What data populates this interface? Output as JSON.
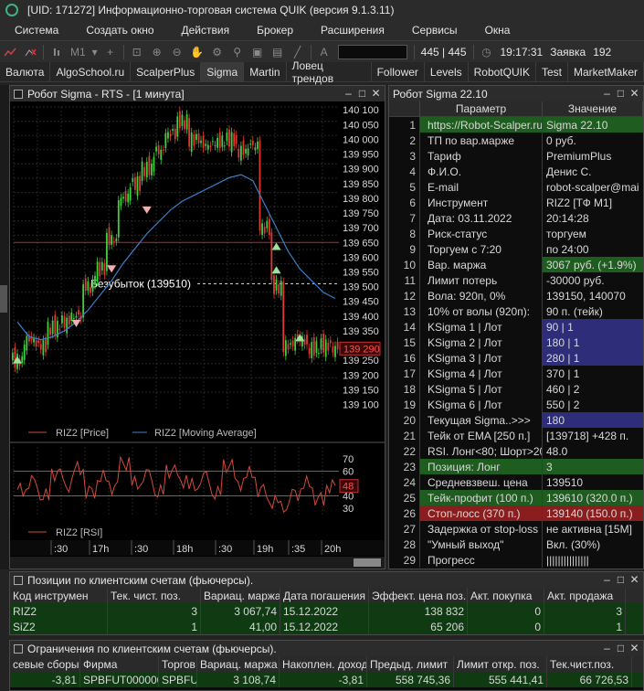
{
  "window": {
    "title": "[UID: 171272] Информационно-торговая система QUIK (версия 9.1.3.11)"
  },
  "menu": [
    "Система",
    "Создать окно",
    "Действия",
    "Брокер",
    "Расширения",
    "Сервисы",
    "Окна"
  ],
  "toolbar": {
    "timeframe": "M1",
    "counter": "445 | 445",
    "time": "19:17:31",
    "orders_label": "Заявка",
    "orders_count": "192"
  },
  "tabs": [
    "Валюта",
    "AlgoSchool.ru",
    "ScalperPlus",
    "Sigma",
    "Martin",
    "Ловец трендов",
    "Follower",
    "Levels",
    "RobotQUIK",
    "Test",
    "MarketMaker"
  ],
  "active_tab": "Sigma",
  "chart_window": {
    "title": "Робот Sigma - RTS  - [1 минута]"
  },
  "chart_data": [
    {
      "type": "line",
      "series": [
        {
          "name": "RIZ2 [Price]",
          "color": "#d24a3a"
        },
        {
          "name": "RIZ2 [Moving Average]",
          "color": "#3a7fc8"
        }
      ],
      "x": [
        "13:15",
        "13:30",
        "13:45",
        "14:00",
        "14:15",
        "14:30",
        "14:45",
        "15:00",
        "15:15",
        "15:30",
        "15:45",
        "16:00",
        "16:15",
        "16:30",
        "16:45",
        "17:00",
        "17:15",
        "17:30",
        "17:45",
        "18:00",
        "18:15",
        "18:30",
        "18:45",
        "19:00",
        "19:15",
        "19:30",
        "19:45",
        "20:00"
      ],
      "price": [
        139250,
        139320,
        139300,
        139360,
        139380,
        139400,
        139500,
        139560,
        139660,
        139800,
        139850,
        139900,
        139960,
        140020,
        140060,
        140000,
        139980,
        139990,
        140000,
        139960,
        139980,
        139700,
        139500,
        139300,
        139320,
        139290,
        139300,
        139290
      ],
      "ma": [
        139380,
        139330,
        139320,
        139330,
        139350,
        139380,
        139420,
        139470,
        139520,
        139580,
        139630,
        139680,
        139720,
        139760,
        139790,
        139810,
        139830,
        139850,
        139870,
        139880,
        139860,
        139780,
        139700,
        139620,
        139560,
        139520,
        139480,
        139460
      ],
      "ylim": [
        139080,
        140110
      ],
      "yticks": [
        "140 100",
        "140 050",
        "140 000",
        "139 950",
        "139 900",
        "139 850",
        "139 800",
        "139 750",
        "139 700",
        "139 650",
        "139 600",
        "139 550",
        "139 500",
        "139 450",
        "139 400",
        "139 350",
        "139 300",
        "139 250",
        "139 200",
        "139 150",
        "139 100"
      ],
      "risk_level": 139650,
      "breakeven": {
        "label": "Безубыток (139510)",
        "value": 139510
      },
      "last_price": "139 290"
    },
    {
      "type": "line",
      "series": [
        {
          "name": "RIZ2 [RSI]",
          "color": "#d24a3a"
        }
      ],
      "ylim": [
        25,
        75
      ],
      "yticks": [
        "70",
        "60",
        "50",
        "40",
        "30"
      ],
      "levels": [
        60,
        40
      ],
      "last_value": "48",
      "values": [
        45,
        52,
        40,
        58,
        48,
        62,
        44,
        55,
        47,
        66,
        50,
        58,
        43,
        60,
        52,
        48,
        56,
        42,
        64,
        50,
        58,
        45,
        35,
        30,
        42,
        50,
        38,
        48
      ],
      "xticks": [
        ":30",
        "17h",
        ":30",
        "18h",
        ":30",
        "19h",
        ":35",
        "20h"
      ]
    }
  ],
  "params": {
    "title": "Робот Sigma 22.10",
    "col_param": "Параметр",
    "col_value": "Значение",
    "rows": [
      {
        "n": "1",
        "p": "https://Robot-Scalper.ru",
        "v": "Sigma 22.10",
        "c": "green"
      },
      {
        "n": "2",
        "p": "ТП по вар.марже",
        "v": "0 руб.",
        "c": ""
      },
      {
        "n": "3",
        "p": "Тариф",
        "v": "PremiumPlus",
        "c": ""
      },
      {
        "n": "4",
        "p": "Ф.И.О.",
        "v": "Денис С.",
        "c": ""
      },
      {
        "n": "5",
        "p": "E-mail",
        "v": "robot-scalper@mai",
        "c": ""
      },
      {
        "n": "6",
        "p": "Инструмент",
        "v": "RIZ2  [ТФ M1]",
        "c": ""
      },
      {
        "n": "7",
        "p": "Дата: 03.11.2022",
        "v": "20:14:28",
        "c": ""
      },
      {
        "n": "8",
        "p": "Риск-статус",
        "v": "торгуем",
        "c": ""
      },
      {
        "n": "9",
        "p": "Торгуем с 7:20",
        "v": "по 24:00",
        "c": ""
      },
      {
        "n": "10",
        "p": "Вар. маржа",
        "v": "3067 руб. (+1.9%)",
        "c": "vgreen"
      },
      {
        "n": "11",
        "p": "Лимит потерь",
        "v": "-30000 руб.",
        "c": ""
      },
      {
        "n": "12",
        "p": "Вола: 920п, 0%",
        "v": "139150, 140070",
        "c": ""
      },
      {
        "n": "13",
        "p": "10% от волы (920п):",
        "v": "90 п. (тейк)",
        "c": ""
      },
      {
        "n": "14",
        "p": "KSigma 1 | Лот",
        "v": "90 | 1",
        "c": "vblue"
      },
      {
        "n": "15",
        "p": "KSigma 2 | Лот",
        "v": "180 | 1",
        "c": "vblue"
      },
      {
        "n": "16",
        "p": "KSigma 3 | Лот",
        "v": "280 | 1",
        "c": "vblue"
      },
      {
        "n": "17",
        "p": "KSigma 4 | Лот",
        "v": "370 | 1",
        "c": ""
      },
      {
        "n": "18",
        "p": "KSigma 5 | Лот",
        "v": "460 | 2",
        "c": ""
      },
      {
        "n": "19",
        "p": "KSigma 6 | Лот",
        "v": "550 | 2",
        "c": ""
      },
      {
        "n": "20",
        "p": "Текущая Sigma..>>>",
        "v": "180",
        "c": "vblue"
      },
      {
        "n": "21",
        "p": "Тейк от EMA [250 п.]",
        "v": "[139718] +428 п.",
        "c": ""
      },
      {
        "n": "22",
        "p": "RSI. Лонг<80; Шорт>20",
        "v": "48.0",
        "c": ""
      },
      {
        "n": "23",
        "p": "Позиция: Лонг",
        "v": "3",
        "c": "green"
      },
      {
        "n": "24",
        "p": "Средневзвеш. цена",
        "v": "139510",
        "c": ""
      },
      {
        "n": "25",
        "p": "Тейк-профит (100 п.)",
        "v": "139610 (320.0 п.)",
        "c": "green"
      },
      {
        "n": "26",
        "p": "Стоп-лосс (370 п.)",
        "v": "139140 (150.0 п.)",
        "c": "red"
      },
      {
        "n": "27",
        "p": "Задержка от stop-loss",
        "v": "не активна [15M]",
        "c": ""
      },
      {
        "n": "28",
        "p": "\"Умный выход\"",
        "v": "Вкл. (30%)",
        "c": ""
      },
      {
        "n": "29",
        "p": "Прогресс",
        "v": "|||||||||||||||",
        "c": ""
      }
    ]
  },
  "positions": {
    "title": "Позиции по клиентским счетам (фьючерсы).",
    "headers": [
      "Код инструмен",
      "Тек. чист. поз.",
      "Вариац. маржа",
      "Дата погашения",
      "Эффект. цена поз.",
      "Акт. покупка",
      "Акт. продажа"
    ],
    "rows": [
      [
        "RIZ2",
        "3",
        "3 067,74",
        "15.12.2022",
        "138 832",
        "0",
        "3"
      ],
      [
        "SiZ2",
        "1",
        "41,00",
        "15.12.2022",
        "65 206",
        "0",
        "1"
      ]
    ]
  },
  "limits": {
    "title": "Ограничения по клиентским счетам (фьючерсы).",
    "headers": [
      "севые сборы",
      "Фирма",
      "Торгов",
      "Вариац. маржа",
      "Накоплен. доход",
      "Предыд. лимит",
      "Лимит откр. поз.",
      "Тек.чист.поз."
    ],
    "rows": [
      [
        "-3,81",
        "SPBFUT000000",
        "SPBFUT",
        "3 108,74",
        "-3,81",
        "558 745,36",
        "555 441,41",
        "66 726,53"
      ]
    ]
  }
}
